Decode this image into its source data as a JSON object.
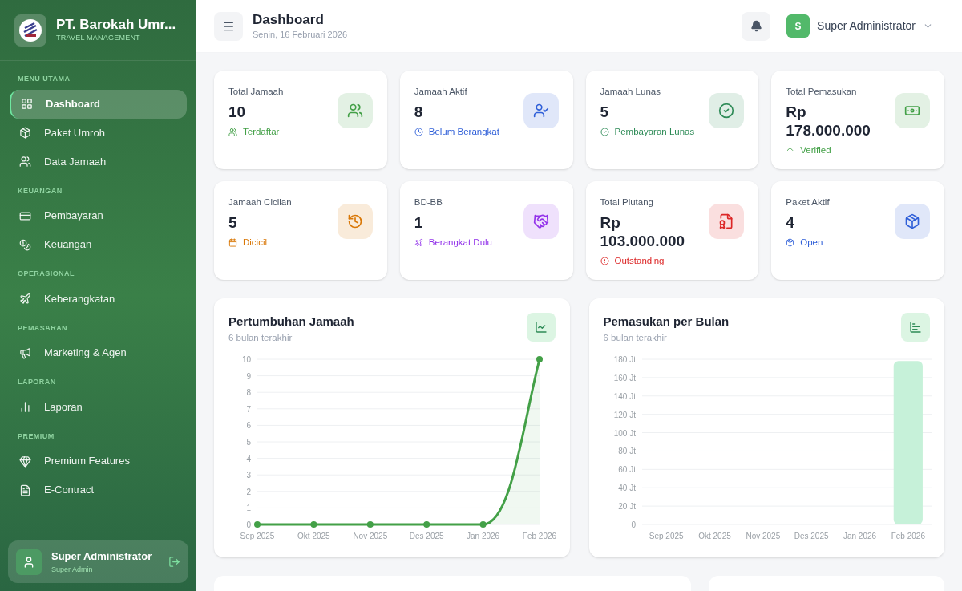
{
  "sidebar": {
    "brand": {
      "name": "PT. Barokah Umr...",
      "tagline": "TRAVEL MANAGEMENT"
    },
    "sections": [
      {
        "heading": "MENU UTAMA",
        "items": [
          {
            "label": "Dashboard",
            "kind": "grid",
            "selected": true
          },
          {
            "label": "Paket Umroh",
            "kind": "box",
            "selected": false
          },
          {
            "label": "Data Jamaah",
            "kind": "users",
            "selected": false
          }
        ]
      },
      {
        "heading": "KEUANGAN",
        "items": [
          {
            "label": "Pembayaran",
            "kind": "card",
            "selected": false
          },
          {
            "label": "Keuangan",
            "kind": "coins",
            "selected": false
          }
        ]
      },
      {
        "heading": "OPERASIONAL",
        "items": [
          {
            "label": "Keberangkatan",
            "kind": "plane",
            "selected": false
          }
        ]
      },
      {
        "heading": "PEMASARAN",
        "items": [
          {
            "label": "Marketing & Agen",
            "kind": "megaphone",
            "selected": false
          }
        ]
      },
      {
        "heading": "LAPORAN",
        "items": [
          {
            "label": "Laporan",
            "kind": "report",
            "selected": false
          }
        ]
      },
      {
        "heading": "PREMIUM",
        "items": [
          {
            "label": "Premium Features",
            "kind": "gem",
            "selected": false
          },
          {
            "label": "E-Contract",
            "kind": "file",
            "selected": false
          }
        ]
      }
    ],
    "user": {
      "name": "Super Administrator",
      "role": "Super Admin"
    }
  },
  "header": {
    "title": "Dashboard",
    "date": "Senin, 16 Februari 2026",
    "user_initial": "S",
    "user_name": "Super Administrator"
  },
  "stats": [
    {
      "label": "Total Jamaah",
      "value": "10",
      "note": "Terdaftar",
      "kind": "users",
      "color": "#43a047"
    },
    {
      "label": "Jamaah Aktif",
      "value": "8",
      "note": "Belum Berangkat",
      "kind": "user-check",
      "color": "#2f5fd8"
    },
    {
      "label": "Jamaah Lunas",
      "value": "5",
      "note": "Pembayaran Lunas",
      "kind": "check",
      "color": "#2e8b57"
    },
    {
      "label": "Total Pemasukan",
      "value": "Rp 178.000.000",
      "note": "Verified",
      "kind": "money",
      "color": "#43a047"
    },
    {
      "label": "Jamaah Cicilan",
      "value": "5",
      "note": "Dicicil",
      "kind": "history",
      "color": "#d97706"
    },
    {
      "label": "BD-BB",
      "value": "1",
      "note": "Berangkat Dulu",
      "kind": "handshake",
      "color": "#9333ea"
    },
    {
      "label": "Total Piutang",
      "value": "Rp 103.000.000",
      "note": "Outstanding",
      "kind": "invoice",
      "color": "#dc2626"
    },
    {
      "label": "Paket Aktif",
      "value": "4",
      "note": "Open",
      "kind": "box",
      "color": "#2f5fd8"
    }
  ],
  "charts": [
    {
      "title": "Pertumbuhan Jamaah",
      "subtitle": "6 bulan terakhir",
      "chart_data": {
        "type": "area",
        "grid": true,
        "categories": [
          "Sep 2025",
          "Okt 2025",
          "Nov 2025",
          "Des 2025",
          "Jan 2026",
          "Feb 2026"
        ],
        "series": [
          {
            "color": "#43a047",
            "values": [
              0,
              0,
              0,
              0,
              0,
              10
            ]
          }
        ],
        "ylim": [
          0,
          10
        ],
        "yticks": [
          0,
          1,
          2,
          3,
          4,
          5,
          6,
          7,
          8,
          9,
          10
        ]
      }
    },
    {
      "title": "Pemasukan per Bulan",
      "subtitle": "6 bulan terakhir",
      "chart_data": {
        "type": "bar",
        "grid": true,
        "categories": [
          "Sep 2025",
          "Okt 2025",
          "Nov 2025",
          "Des 2025",
          "Jan 2026",
          "Feb 2026"
        ],
        "series": [
          {
            "color": "#c6f1d9",
            "values": [
              0,
              0,
              0,
              0,
              0,
              178
            ]
          }
        ],
        "ylim": [
          0,
          180
        ],
        "yticks": [
          0,
          {
            "value": 20,
            "label": "20 Jt"
          },
          {
            "value": 40,
            "label": "40 Jt"
          },
          {
            "value": 60,
            "label": "60 Jt"
          },
          {
            "value": 80,
            "label": "80 Jt"
          },
          {
            "value": 100,
            "label": "100 Jt"
          },
          {
            "value": 120,
            "label": "120 Jt"
          },
          {
            "value": 140,
            "label": "140 Jt"
          },
          {
            "value": 160,
            "label": "160 Jt"
          },
          {
            "value": 180,
            "label": "180 Jt"
          }
        ]
      }
    }
  ]
}
